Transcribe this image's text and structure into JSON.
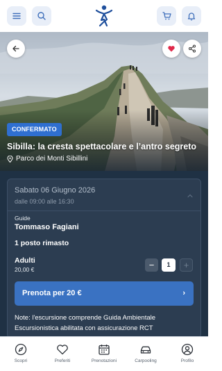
{
  "header": {
    "menu_icon": "menu-icon",
    "search_icon": "search-icon",
    "logo": "brand-logo",
    "cart_icon": "cart-icon",
    "bell_icon": "bell-icon"
  },
  "hero": {
    "back_icon": "arrow-left-icon",
    "favorite_icon": "heart-icon",
    "share_icon": "share-icon",
    "badge": "CONFERMATO",
    "title": "Sibilla: la cresta spettacolare e l’antro segreto",
    "location": "Parco dei Monti Sibillini"
  },
  "booking": {
    "date": "Sabato 06 Giugno 2026",
    "time": "dalle 09:00 alle 16:30",
    "guide_label": "Guide",
    "guide_name": "Tommaso Fagiani",
    "spots": "1 posto rimasto",
    "ticket_label": "Adulti",
    "ticket_price": "20,00 €",
    "quantity": "1",
    "minus": "−",
    "plus": "+",
    "book_label": "Prenota per 20 €",
    "book_arrow": "›",
    "note": "Note: l'escursione comprende Guida Ambientale Escursionistica abilitata con assicurazione RCT"
  },
  "nav": {
    "items": [
      {
        "label": "Scopri",
        "icon": "compass-icon"
      },
      {
        "label": "Preferiti",
        "icon": "heart-icon"
      },
      {
        "label": "Prenotazioni",
        "icon": "calendar-icon"
      },
      {
        "label": "Carpooling",
        "icon": "car-icon"
      },
      {
        "label": "Profilo",
        "icon": "user-icon"
      }
    ]
  },
  "colors": {
    "accent": "#2f6fd0",
    "button": "#3a72c2",
    "card": "#2c3d51",
    "background_dark": "#1f3144",
    "favorite": "#e0294a",
    "header_button": "#e8eef8"
  }
}
